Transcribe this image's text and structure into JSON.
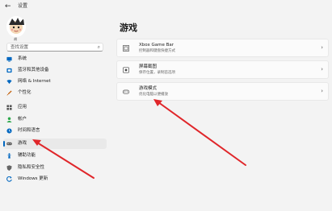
{
  "window": {
    "title": "设置",
    "back_glyph": "←"
  },
  "user": {
    "name": "胡"
  },
  "search": {
    "placeholder": "查找设置",
    "icon": "search-icon"
  },
  "sidebar": {
    "items": [
      {
        "label": "系统",
        "icon": "system-icon",
        "color": "#0067c0"
      },
      {
        "label": "蓝牙和其他设备",
        "icon": "bluetooth-icon",
        "color": "#0067c0"
      },
      {
        "label": "网络 & Internet",
        "icon": "network-icon",
        "color": "#0067c0"
      },
      {
        "label": "个性化",
        "icon": "personalization-icon",
        "color": "#c05a00"
      },
      {
        "label": "应用",
        "icon": "apps-icon",
        "color": "#555555"
      },
      {
        "label": "帐户",
        "icon": "account-icon",
        "color": "#2ba84a"
      },
      {
        "label": "时间和语言",
        "icon": "time-language-icon",
        "color": "#0067c0"
      },
      {
        "label": "游戏",
        "icon": "gaming-icon",
        "color": "#555555",
        "selected": true
      },
      {
        "label": "辅助功能",
        "icon": "accessibility-icon",
        "color": "#0067c0"
      },
      {
        "label": "隐私和安全性",
        "icon": "privacy-shield-icon",
        "color": "#555555"
      },
      {
        "label": "Windows 更新",
        "icon": "windows-update-icon",
        "color": "#0067c0"
      }
    ]
  },
  "main": {
    "title": "游戏",
    "cards": [
      {
        "title": "Xbox Game Bar",
        "subtitle": "控制器和键盘快捷方式",
        "icon": "xbox-icon"
      },
      {
        "title": "屏幕截图",
        "subtitle": "保存位置，录制首选项",
        "icon": "capture-icon"
      },
      {
        "title": "游戏模式",
        "subtitle": "优化电脑以便播放",
        "icon": "game-mode-icon"
      }
    ],
    "chevron_glyph": "›"
  },
  "colors": {
    "accent": "#0067c0",
    "annotation_arrow": "#e0262a"
  }
}
